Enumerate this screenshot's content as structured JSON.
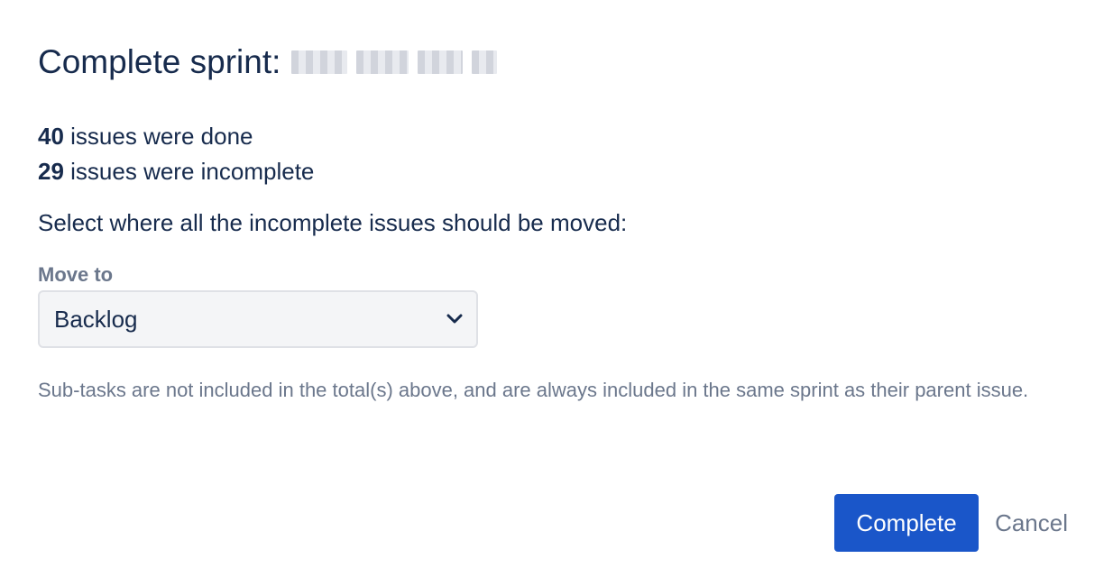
{
  "dialog": {
    "title_prefix": "Complete sprint:",
    "sprint_name_redacted": true,
    "stats": {
      "done_count": "40",
      "done_label": " issues were done",
      "incomplete_count": "29",
      "incomplete_label": " issues were incomplete"
    },
    "instruction": "Select where all the incomplete issues should be moved:",
    "move_to": {
      "label": "Move to",
      "selected": "Backlog"
    },
    "note": "Sub-tasks are not included in the total(s) above, and are always included in the same sprint as their parent issue.",
    "buttons": {
      "complete": "Complete",
      "cancel": "Cancel"
    },
    "colors": {
      "primary": "#1a56c9",
      "text": "#172b4d",
      "subtle": "#6b778c",
      "field_bg": "#f4f5f7"
    }
  }
}
